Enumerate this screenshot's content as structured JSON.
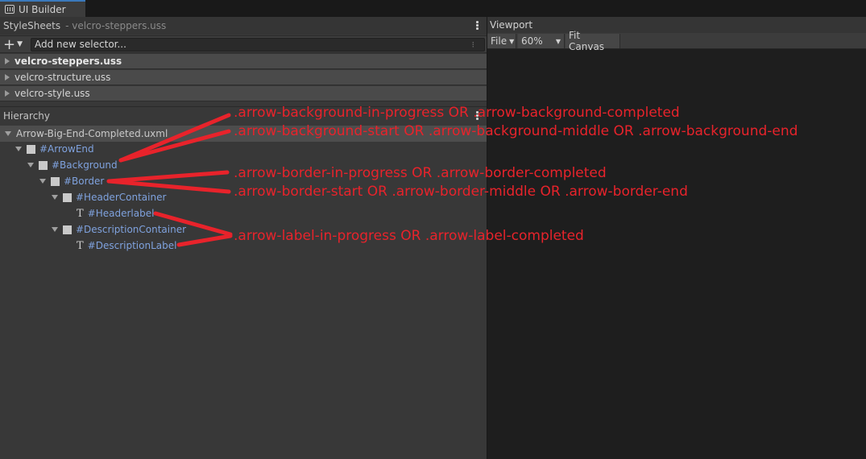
{
  "tab": {
    "title": "UI Builder"
  },
  "stylesheets": {
    "title": "StyleSheets",
    "subtitle": "- velcro-steppers.uss",
    "add_label": "+",
    "selector_placeholder": "Add new selector...",
    "grip": "⁝",
    "sheets": [
      {
        "label": "velcro-steppers.uss"
      },
      {
        "label": "velcro-structure.uss"
      },
      {
        "label": "velcro-style.uss"
      }
    ]
  },
  "hierarchy": {
    "title": "Hierarchy",
    "root": "Arrow-Big-End-Completed.uxml",
    "items": [
      {
        "label": "#ArrowEnd"
      },
      {
        "label": "#Background"
      },
      {
        "label": "#Border"
      },
      {
        "label": "#HeaderContainer"
      },
      {
        "label": "#Headerlabel"
      },
      {
        "label": "#DescriptionContainer"
      },
      {
        "label": "#DescriptionLabel"
      }
    ]
  },
  "viewport": {
    "title": "Viewport",
    "file_label": "File",
    "zoom_label": "60%",
    "fit_label": "Fit Canvas"
  },
  "annotations": [
    {
      "text": ".arrow-background-in-progress OR .arrow-background-completed"
    },
    {
      "text": ".arrow-background-start OR .arrow-background-middle OR .arrow-background-end"
    },
    {
      "text": ".arrow-border-in-progress OR .arrow-border-completed"
    },
    {
      "text": ".arrow-border-start OR .arrow-border-middle OR .arrow-border-end"
    },
    {
      "text": ".arrow-label-in-progress OR .arrow-label-completed"
    }
  ],
  "colors": {
    "annotation": "#e8232b",
    "element_name": "#7fa2de",
    "tab_accent": "#3a79bb"
  }
}
